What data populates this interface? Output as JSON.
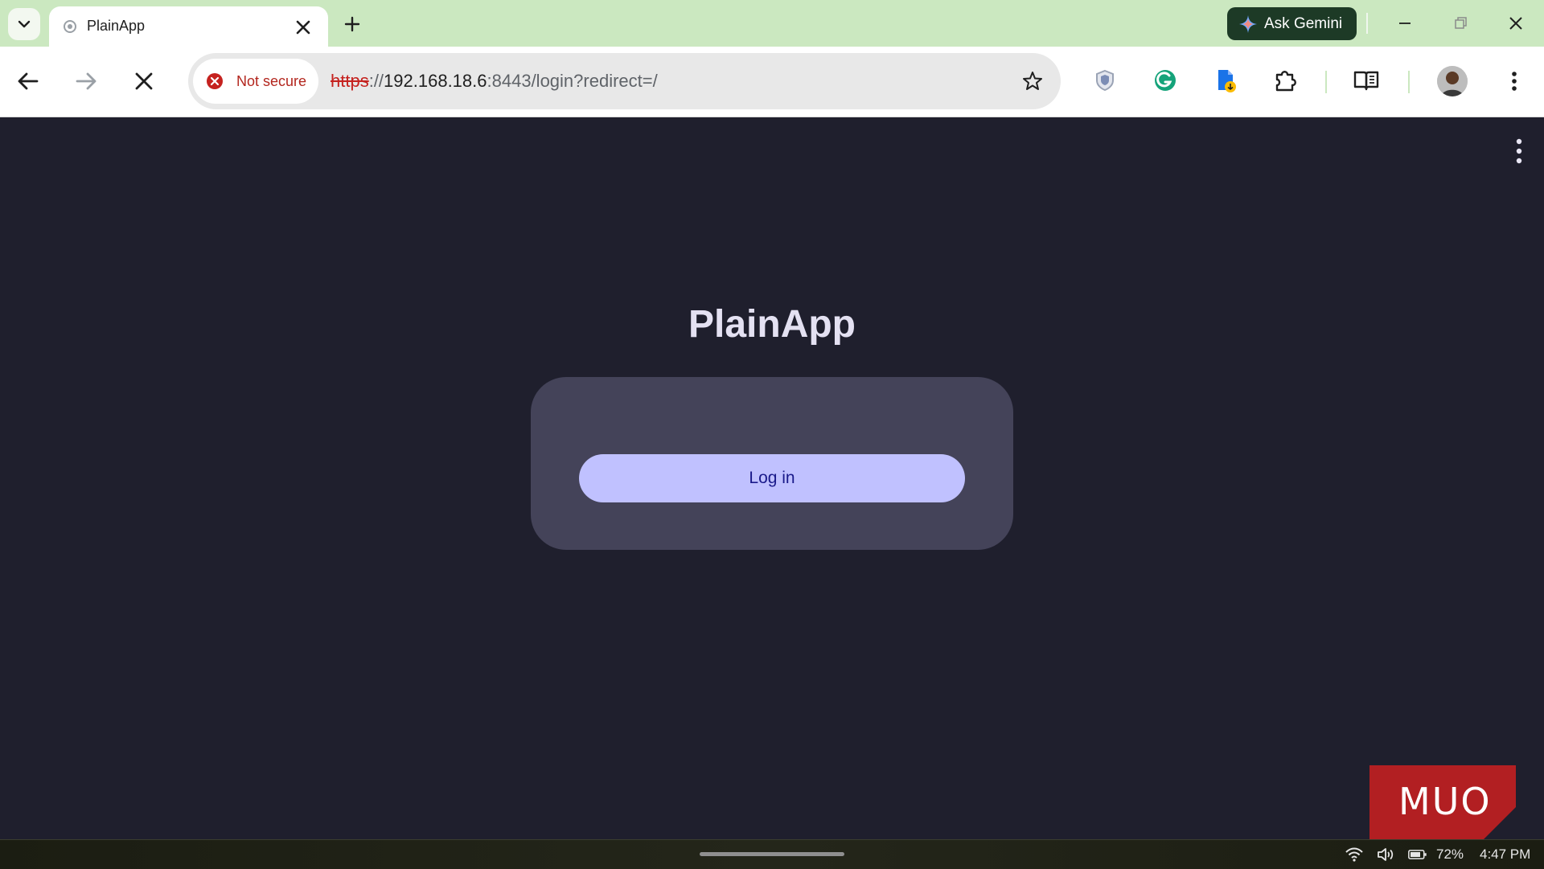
{
  "browser": {
    "tab": {
      "title": "PlainApp"
    },
    "gemini_label": "Ask Gemini",
    "omnibox": {
      "security_label": "Not secure",
      "url_scheme": "https",
      "url_sep": "://",
      "url_host": "192.168.18.6",
      "url_rest": ":8443/login?redirect=/"
    }
  },
  "page": {
    "app_title": "PlainApp",
    "login_button_label": "Log in",
    "watermark_text": "MUO"
  },
  "taskbar": {
    "battery_percent": "72%",
    "time": "4:47 PM"
  },
  "colors": {
    "tabstrip_bg": "#cbe8c0",
    "page_bg": "#1f1f2d",
    "card_bg": "#444359",
    "button_bg": "#c0c1ff",
    "button_text": "#1a1a8a",
    "not_secure": "#b3261e",
    "watermark_bg": "#b21f22"
  }
}
